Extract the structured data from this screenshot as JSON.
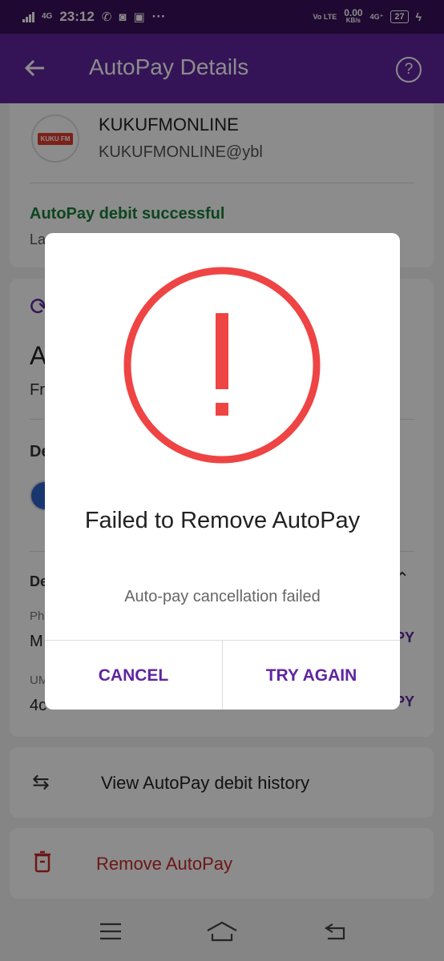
{
  "status_bar": {
    "network_left": "4G",
    "time": "23:12",
    "notifications": [
      "whatsapp-icon",
      "instagram-icon",
      "mic-icon"
    ],
    "more_dots": "···",
    "volte": "Vo LTE",
    "speed_value": "0.00",
    "speed_unit": "KB/s",
    "network_right": "4G⁺",
    "battery": "27"
  },
  "app_bar": {
    "title": "AutoPay Details"
  },
  "merchant": {
    "logo_text": "KUKU FM",
    "name": "KUKUFMONLINE",
    "upi_id": "KUKUFMONLINE@ybl",
    "status": "AutoPay debit successful",
    "last_partial": "La"
  },
  "mandate": {
    "amount_partial": "A",
    "frequency_partial": "Fr",
    "debit_partial": "De",
    "details_partial": "De",
    "phone_label_partial": "Ph",
    "phone_value_partial": "M",
    "umn_label_partial": "UM",
    "umn_value_partial": "4c",
    "copy_label": "PY"
  },
  "actions": {
    "history_label": "View AutoPay debit history",
    "remove_label": "Remove AutoPay"
  },
  "dialog": {
    "title": "Failed to Remove AutoPay",
    "message": "Auto-pay cancellation failed",
    "cancel_label": "CANCEL",
    "retry_label": "TRY AGAIN"
  },
  "colors": {
    "brand": "#5f259f",
    "status_bar": "#3a0f59",
    "success": "#1b7f3b",
    "danger": "#c62828",
    "alert": "#ef4444"
  }
}
